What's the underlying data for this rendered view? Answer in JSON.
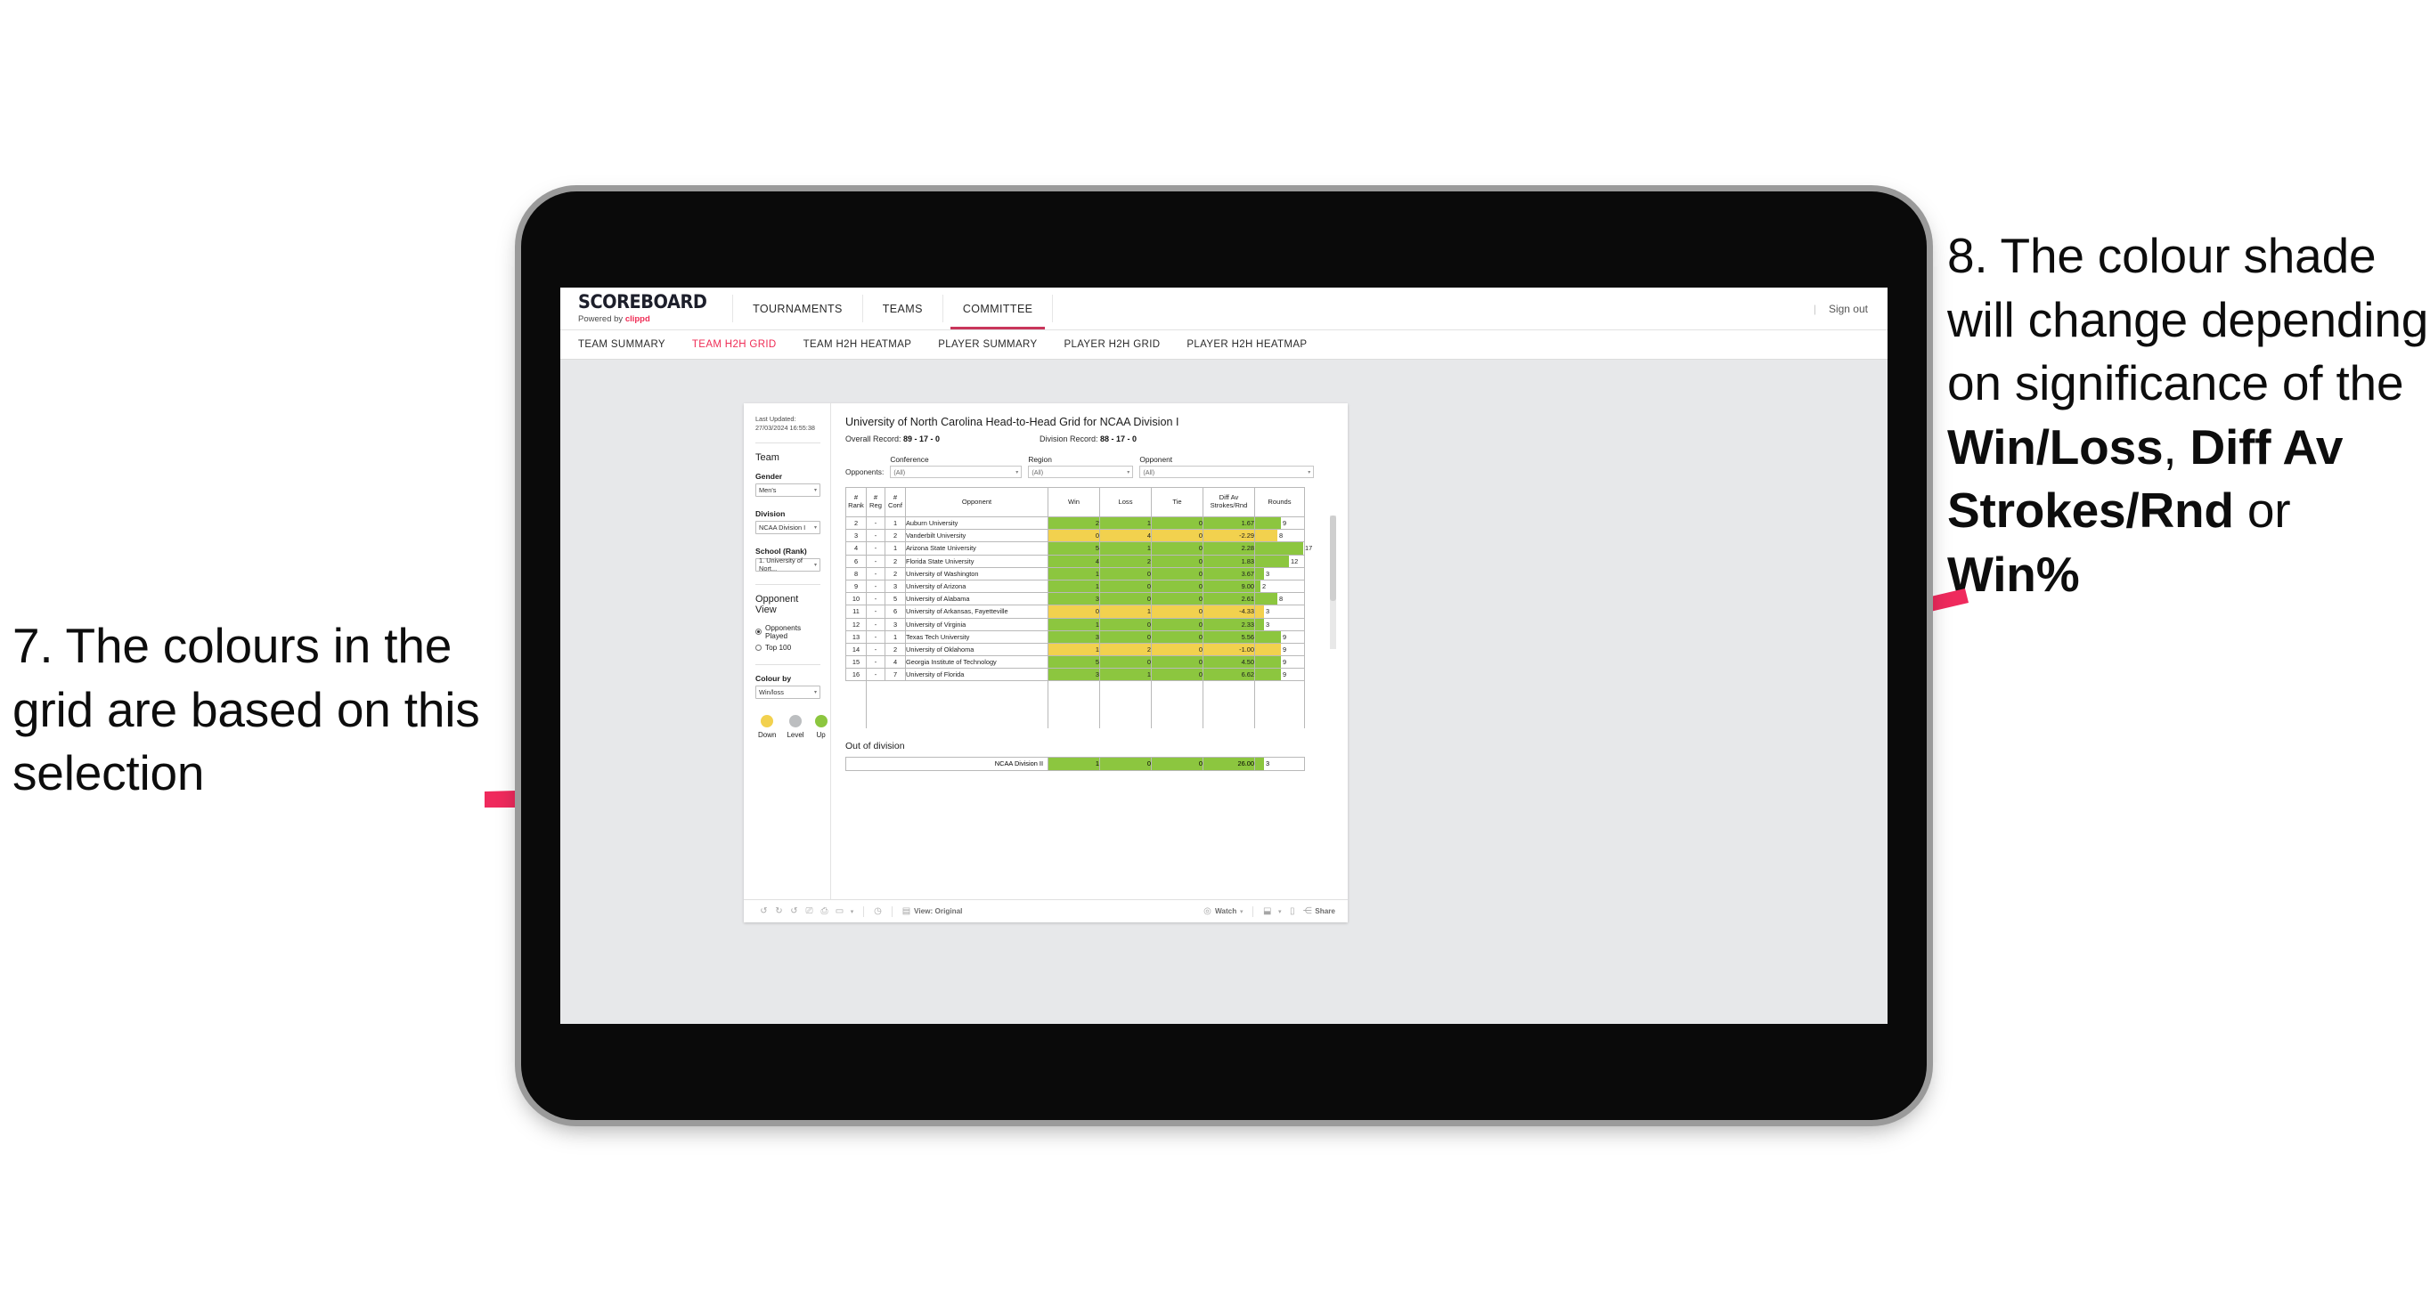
{
  "annotations": {
    "left": {
      "number": "7.",
      "text": "7. The colours in the grid are based on this selection"
    },
    "right": {
      "line1": "8. The colour shade will change depending on significance of the ",
      "bold1": "Win/Loss",
      "mid1": ", ",
      "bold2": "Diff Av Strokes/Rnd",
      "mid2": " or ",
      "bold3": "Win%"
    },
    "arrow_color": "#ef2a5d"
  },
  "app": {
    "brand": {
      "title": "SCOREBOARD",
      "powered_prefix": "Powered by ",
      "powered_brand": "clippd"
    },
    "nav": [
      {
        "label": "TOURNAMENTS",
        "active": false
      },
      {
        "label": "TEAMS",
        "active": false
      },
      {
        "label": "COMMITTEE",
        "active": true
      }
    ],
    "sign_out": "Sign out",
    "separator": "|",
    "subnav": [
      {
        "label": "TEAM SUMMARY",
        "active": false
      },
      {
        "label": "TEAM H2H GRID",
        "active": true
      },
      {
        "label": "TEAM H2H HEATMAP",
        "active": false
      },
      {
        "label": "PLAYER SUMMARY",
        "active": false
      },
      {
        "label": "PLAYER H2H GRID",
        "active": false
      },
      {
        "label": "PLAYER H2H HEATMAP",
        "active": false
      }
    ]
  },
  "sidebar": {
    "last_updated": "Last Updated: 27/03/2024 16:55:38",
    "team_heading": "Team",
    "fields": [
      {
        "label": "Gender",
        "value": "Men's"
      },
      {
        "label": "Division",
        "value": "NCAA Division I"
      },
      {
        "label": "School (Rank)",
        "value": "1. University of Nort..."
      }
    ],
    "opponent_view_heading": "Opponent View",
    "opponent_view_options": [
      {
        "label": "Opponents Played",
        "selected": true
      },
      {
        "label": "Top 100",
        "selected": false
      }
    ],
    "colour_by_label": "Colour by",
    "colour_by_value": "Win/loss",
    "legend": [
      {
        "label": "Down",
        "color": "#f2d14e"
      },
      {
        "label": "Level",
        "color": "#bcbec0"
      },
      {
        "label": "Up",
        "color": "#8cc63f"
      }
    ]
  },
  "main": {
    "title": "University of North Carolina Head-to-Head Grid for NCAA Division I",
    "overall_record_label": "Overall Record: ",
    "overall_record_value": "89 - 17 - 0",
    "division_record_label": "Division Record: ",
    "division_record_value": "88 - 17 - 0",
    "opponents_label": "Opponents:",
    "filters": [
      {
        "label": "Conference",
        "value": "(All)"
      },
      {
        "label": "Region",
        "value": "(All)"
      },
      {
        "label": "Opponent",
        "value": "(All)"
      }
    ],
    "columns": [
      "# Rank",
      "# Reg",
      "# Conf",
      "Opponent",
      "Win",
      "Loss",
      "Tie",
      "Diff Av Strokes/Rnd",
      "Rounds"
    ],
    "out_of_division_title": "Out of division",
    "out_of_division_row": {
      "name": "NCAA Division II",
      "win": "1",
      "loss": "0",
      "tie": "0",
      "diff": "26.00",
      "rounds": "3"
    }
  },
  "chart_data": {
    "type": "table",
    "title": "University of North Carolina Head-to-Head Grid for NCAA Division I",
    "columns": [
      "#Rank",
      "#Reg",
      "#Conf",
      "Opponent",
      "Win",
      "Loss",
      "Tie",
      "Diff Av Strokes/Rnd",
      "Rounds"
    ],
    "colour_rule": "Win/loss — green = Up (net win), yellow = Down (net loss), grey = Level",
    "rounds_max": 17,
    "rows": [
      {
        "rank": "2",
        "reg": "-",
        "conf": "1",
        "opponent": "Auburn University",
        "win": "2",
        "loss": "1",
        "tie": "0",
        "diff": "1.67",
        "rounds": 9,
        "color": "#8cc63f"
      },
      {
        "rank": "3",
        "reg": "-",
        "conf": "2",
        "opponent": "Vanderbilt University",
        "win": "0",
        "loss": "4",
        "tie": "0",
        "diff": "-2.29",
        "rounds": 8,
        "color": "#f2d14e"
      },
      {
        "rank": "4",
        "reg": "-",
        "conf": "1",
        "opponent": "Arizona State University",
        "win": "5",
        "loss": "1",
        "tie": "0",
        "diff": "2.28",
        "rounds": 17,
        "color": "#8cc63f"
      },
      {
        "rank": "6",
        "reg": "-",
        "conf": "2",
        "opponent": "Florida State University",
        "win": "4",
        "loss": "2",
        "tie": "0",
        "diff": "1.83",
        "rounds": 12,
        "color": "#8cc63f"
      },
      {
        "rank": "8",
        "reg": "-",
        "conf": "2",
        "opponent": "University of Washington",
        "win": "1",
        "loss": "0",
        "tie": "0",
        "diff": "3.67",
        "rounds": 3,
        "color": "#8cc63f"
      },
      {
        "rank": "9",
        "reg": "-",
        "conf": "3",
        "opponent": "University of Arizona",
        "win": "1",
        "loss": "0",
        "tie": "0",
        "diff": "9.00",
        "rounds": 2,
        "color": "#8cc63f"
      },
      {
        "rank": "10",
        "reg": "-",
        "conf": "5",
        "opponent": "University of Alabama",
        "win": "3",
        "loss": "0",
        "tie": "0",
        "diff": "2.61",
        "rounds": 8,
        "color": "#8cc63f"
      },
      {
        "rank": "11",
        "reg": "-",
        "conf": "6",
        "opponent": "University of Arkansas, Fayetteville",
        "win": "0",
        "loss": "1",
        "tie": "0",
        "diff": "-4.33",
        "rounds": 3,
        "color": "#f2d14e"
      },
      {
        "rank": "12",
        "reg": "-",
        "conf": "3",
        "opponent": "University of Virginia",
        "win": "1",
        "loss": "0",
        "tie": "0",
        "diff": "2.33",
        "rounds": 3,
        "color": "#8cc63f"
      },
      {
        "rank": "13",
        "reg": "-",
        "conf": "1",
        "opponent": "Texas Tech University",
        "win": "3",
        "loss": "0",
        "tie": "0",
        "diff": "5.56",
        "rounds": 9,
        "color": "#8cc63f"
      },
      {
        "rank": "14",
        "reg": "-",
        "conf": "2",
        "opponent": "University of Oklahoma",
        "win": "1",
        "loss": "2",
        "tie": "0",
        "diff": "-1.00",
        "rounds": 9,
        "color": "#f2d14e"
      },
      {
        "rank": "15",
        "reg": "-",
        "conf": "4",
        "opponent": "Georgia Institute of Technology",
        "win": "5",
        "loss": "0",
        "tie": "0",
        "diff": "4.50",
        "rounds": 9,
        "color": "#8cc63f"
      },
      {
        "rank": "16",
        "reg": "-",
        "conf": "7",
        "opponent": "University of Florida",
        "win": "3",
        "loss": "1",
        "tie": "0",
        "diff": "6.62",
        "rounds": 9,
        "color": "#8cc63f"
      }
    ],
    "out_of_division": [
      {
        "opponent": "NCAA Division II",
        "win": "1",
        "loss": "0",
        "tie": "0",
        "diff": "26.00",
        "rounds": 3,
        "color": "#8cc63f"
      }
    ]
  },
  "toolbar": {
    "icons": [
      "undo-icon",
      "redo-icon",
      "revert-icon",
      "refresh-icon",
      "pause-icon",
      "rect-select-icon",
      "chevron-down-icon",
      "help-icon"
    ],
    "view_label": "View: Original",
    "watch_label": "Watch",
    "share_label": "Share"
  }
}
